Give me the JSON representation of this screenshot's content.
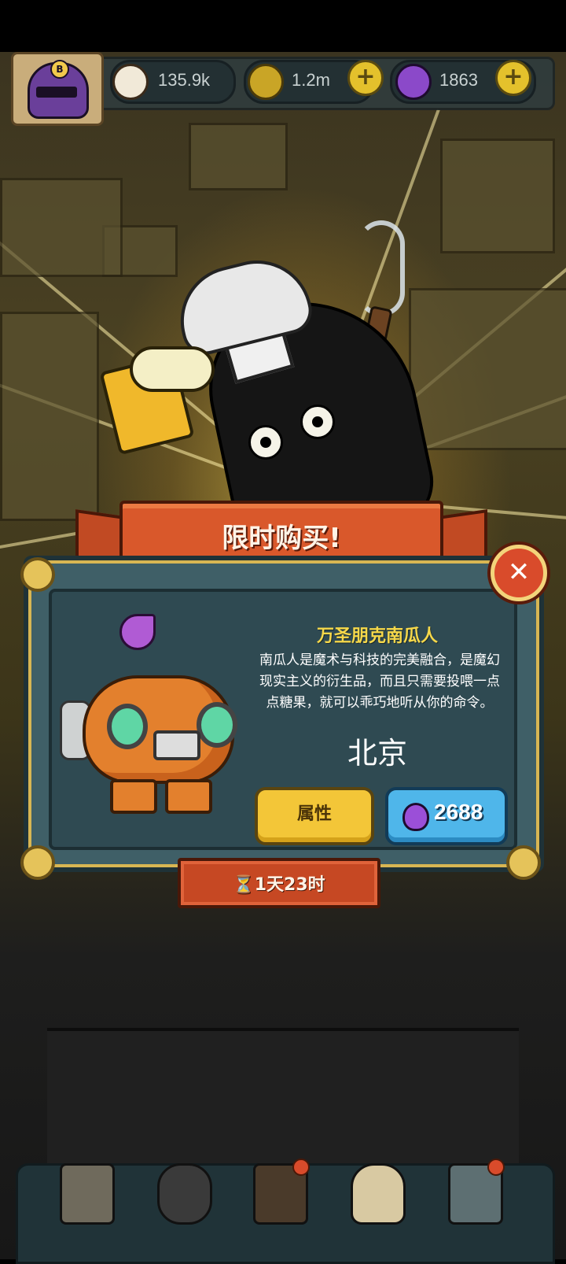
{
  "resources": {
    "eyeballs": "135.9k",
    "coins": "1.2m",
    "potions": "1863"
  },
  "icons": {
    "eyeball": "eyeball-icon",
    "coin": "coin-icon",
    "potion": "potion-icon",
    "plus": "plus-icon",
    "close": "close-icon",
    "hourglass": "hourglass-icon"
  },
  "dialog": {
    "banner_title": "限时购买!",
    "item_name": "万圣朋克南瓜人",
    "description": "南瓜人是魔术与科技的完美融合，是魔幻现实主义的衍生品，而且只需要投喂一点点糖果，就可以乖巧地听从你的命令。",
    "city": "北京",
    "attributes_button": "属性",
    "price": "2688",
    "close_symbol": "✕",
    "timer": "1天23时"
  },
  "plus_symbol": "+",
  "colors": {
    "banner": "#d9582b",
    "dialog": "#3f5f67",
    "title_yellow": "#f6d84a",
    "attr_button": "#f3c638",
    "price_button": "#4fb6ea"
  }
}
